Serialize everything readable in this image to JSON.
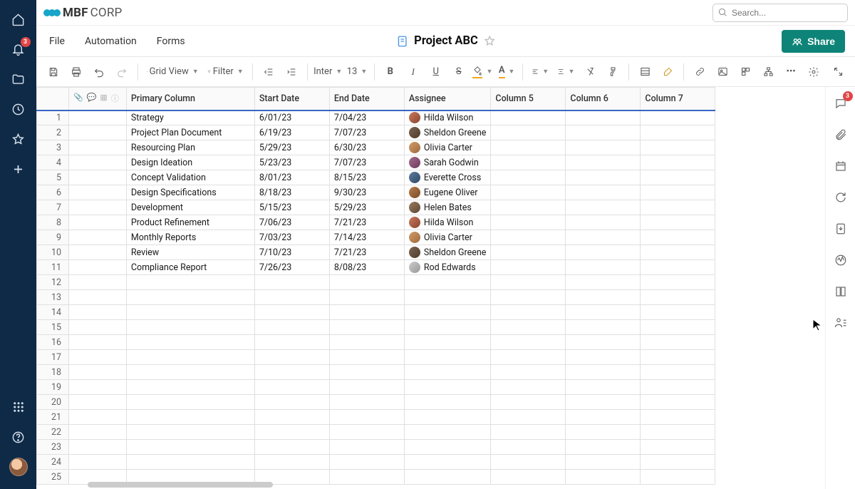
{
  "brand": {
    "name_bold": "MBF",
    "name_light": "CORP"
  },
  "search": {
    "placeholder": "Search..."
  },
  "leftbar": {
    "notification_badge": "3"
  },
  "menubar": {
    "file": "File",
    "automation": "Automation",
    "forms": "Forms"
  },
  "doc": {
    "title": "Project ABC"
  },
  "share_label": "Share",
  "toolbar": {
    "grid_view": "Grid View",
    "filter": "Filter",
    "font": "Inter",
    "font_size": "13"
  },
  "columns": {
    "primary": "Primary Column",
    "start": "Start Date",
    "end": "End Date",
    "assignee": "Assignee",
    "c5": "Column 5",
    "c6": "Column 6",
    "c7": "Column 7"
  },
  "rightbar": {
    "comment_badge": "3"
  },
  "rows": [
    {
      "n": "1",
      "p": "Strategy",
      "s": "6/01/23",
      "e": "7/04/23",
      "a": "Hilda Wilson"
    },
    {
      "n": "2",
      "p": "Project Plan Document",
      "s": "6/19/23",
      "e": "7/07/23",
      "a": "Sheldon Greene"
    },
    {
      "n": "3",
      "p": "Resourcing Plan",
      "s": "5/29/23",
      "e": "6/30/23",
      "a": "Olivia Carter"
    },
    {
      "n": "4",
      "p": "Design Ideation",
      "s": "5/23/23",
      "e": "7/07/23",
      "a": "Sarah Godwin"
    },
    {
      "n": "5",
      "p": "Concept Validation",
      "s": "8/01/23",
      "e": "8/15/23",
      "a": "Everette Cross"
    },
    {
      "n": "6",
      "p": "Design Specifications",
      "s": "8/18/23",
      "e": "9/30/23",
      "a": "Eugene Oliver"
    },
    {
      "n": "7",
      "p": "Development",
      "s": "5/15/23",
      "e": "5/29/23",
      "a": "Helen Bates"
    },
    {
      "n": "8",
      "p": "Product Refinement",
      "s": "7/06/23",
      "e": "7/21/23",
      "a": "Hilda Wilson"
    },
    {
      "n": "9",
      "p": "Monthly Reports",
      "s": "7/03/23",
      "e": "7/14/23",
      "a": "Olivia Carter"
    },
    {
      "n": "10",
      "p": "Review",
      "s": "7/10/23",
      "e": "7/21/23",
      "a": "Sheldon Greene"
    },
    {
      "n": "11",
      "p": "Compliance Report",
      "s": "7/26/23",
      "e": "8/08/23",
      "a": "Rod Edwards"
    }
  ],
  "empty_rows": [
    "12",
    "13",
    "14",
    "15",
    "16",
    "17",
    "18",
    "19",
    "20",
    "21",
    "22",
    "23",
    "24",
    "25"
  ]
}
